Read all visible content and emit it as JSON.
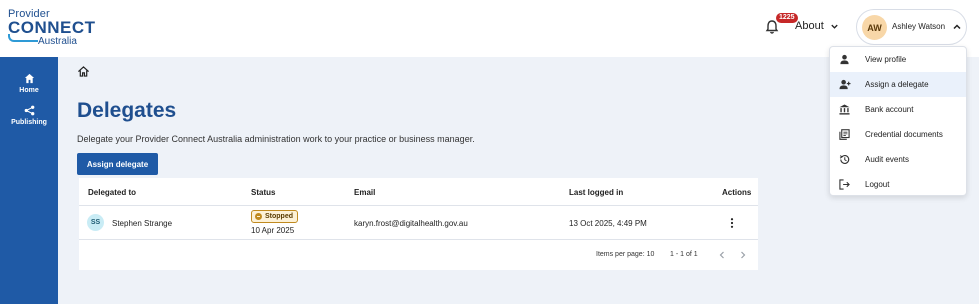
{
  "header": {
    "logo": {
      "line1": "Provider",
      "line2": "CONNECT",
      "line3": "Australia"
    },
    "notification_count": "1225",
    "about_label": "About",
    "user": {
      "initials": "AW",
      "name": "Ashley Watson"
    }
  },
  "sidebar": {
    "items": [
      {
        "label": "Home",
        "icon": "home-icon"
      },
      {
        "label": "Publishing",
        "icon": "share-icon"
      }
    ]
  },
  "main": {
    "title": "Delegates",
    "description": "Delegate your Provider Connect Australia administration work to your practice or business manager.",
    "assign_button": "Assign delegate",
    "table": {
      "headers": [
        "Delegated to",
        "Status",
        "Email",
        "Last logged in",
        "Actions"
      ],
      "rows": [
        {
          "initials": "SS",
          "name": "Stephen Strange",
          "status": "Stopped",
          "status_date": "10 Apr 2025",
          "email": "karyn.frost@digitalhealth.gov.au",
          "last_logged_in": "13 Oct 2025, 4:49 PM"
        }
      ],
      "pagination": {
        "items_per_page": "Items per page: 10",
        "range": "1 - 1 of 1"
      }
    }
  },
  "user_menu": {
    "items": [
      {
        "label": "View profile",
        "icon": "person-icon"
      },
      {
        "label": "Assign a delegate",
        "icon": "person-add-icon"
      },
      {
        "label": "Bank account",
        "icon": "bank-icon"
      },
      {
        "label": "Credential documents",
        "icon": "documents-icon"
      },
      {
        "label": "Audit events",
        "icon": "history-icon"
      },
      {
        "label": "Logout",
        "icon": "logout-icon"
      }
    ],
    "active_index": 1
  },
  "colors": {
    "brand_blue": "#1f5aa6",
    "title_blue": "#1f4f8f",
    "status_stopped": "#c08a1f",
    "badge_red": "#c62828"
  }
}
